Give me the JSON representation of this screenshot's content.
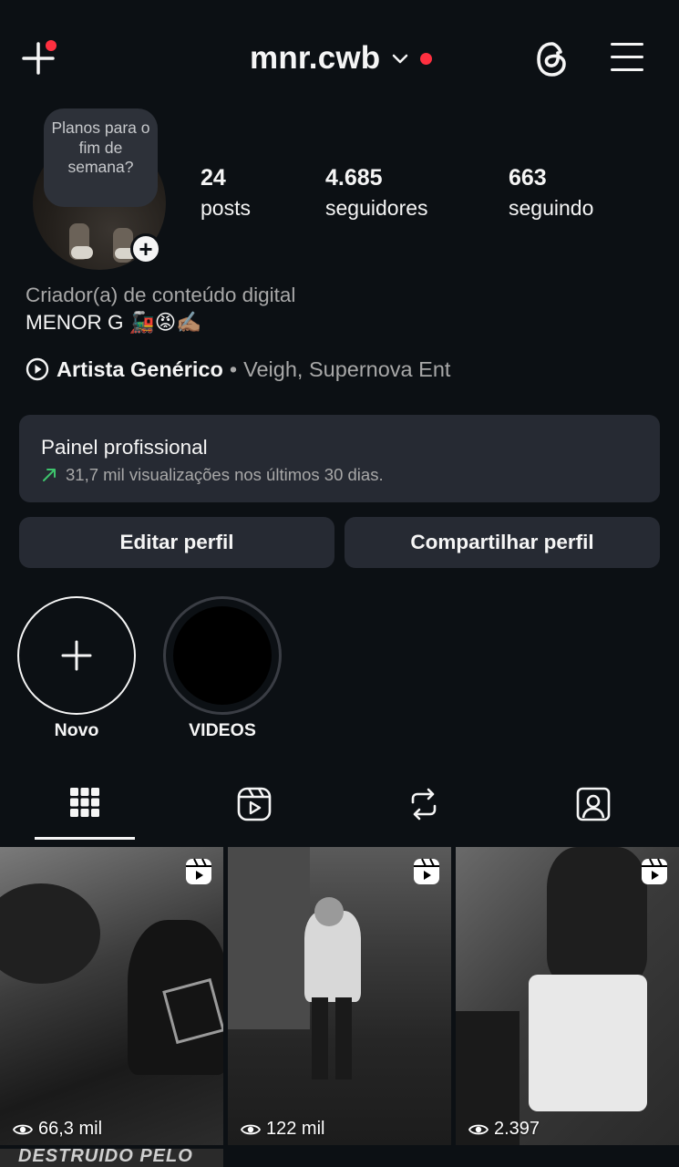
{
  "header": {
    "username": "mnr.cwb",
    "icons": {
      "create": "plus-icon",
      "account_switch": "chevron-down-icon",
      "threads": "threads-icon",
      "menu": "hamburger-menu-icon"
    },
    "notification_dot_color": "#ff3040"
  },
  "profile": {
    "note": "Planos para o fim de semana?",
    "stats": [
      {
        "value": "24",
        "label": "posts"
      },
      {
        "value": "4.685",
        "label": "seguidores"
      },
      {
        "value": "663",
        "label": "seguindo"
      }
    ],
    "category": "Criador(a) de conteúdo digital",
    "bio": "MENOR G 🚂😡✍🏽",
    "artist": {
      "name": "Artista Genérico",
      "separator": "•",
      "extra": "Veigh, Supernova Ent"
    }
  },
  "dashboard": {
    "title": "Painel profissional",
    "subtitle": "31,7 mil visualizações nos últimos 30 dias.",
    "trend_color": "#3ec46d"
  },
  "actions": {
    "edit": "Editar perfil",
    "share": "Compartilhar perfil"
  },
  "highlights": [
    {
      "label": "Novo",
      "icon": "plus-icon"
    },
    {
      "label": "VIDEOS"
    }
  ],
  "tabs": [
    {
      "name": "posts",
      "icon": "grid-icon",
      "active": true
    },
    {
      "name": "reels",
      "icon": "reels-icon",
      "active": false
    },
    {
      "name": "reposts",
      "icon": "repost-icon",
      "active": false
    },
    {
      "name": "tagged",
      "icon": "tagged-icon",
      "active": false
    }
  ],
  "posts": [
    {
      "views": "66,3 mil",
      "type": "reel"
    },
    {
      "views": "122 mil",
      "type": "reel"
    },
    {
      "views": "2.397",
      "type": "reel"
    }
  ],
  "next_row_text": "DESTRUIDO PELO AMOR"
}
